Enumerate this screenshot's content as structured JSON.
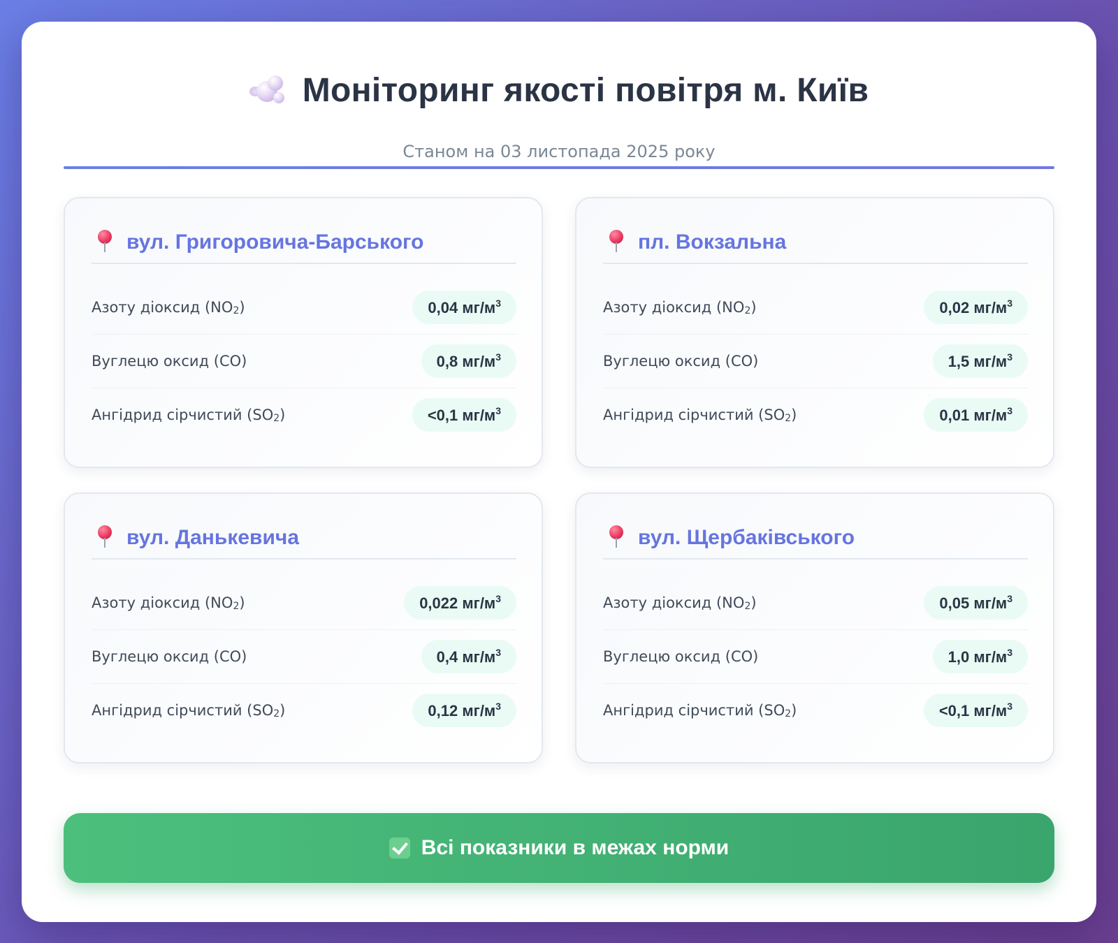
{
  "header": {
    "title": "Моніторинг якості повітря м. Київ",
    "subtitle": "Станом на 03 листопада 2025 року",
    "title_icon": "cloud-icon"
  },
  "unit": "мг/м",
  "unit_sup": "3",
  "stations": [
    {
      "name": "вул. Григоровича-Барського",
      "icon": "pin-icon",
      "readings": [
        {
          "label": "Азоту діоксид (NO",
          "sub": "2",
          "label_end": ")",
          "value": "0,04"
        },
        {
          "label": "Вуглецю оксид (CO)",
          "sub": "",
          "label_end": "",
          "value": "0,8"
        },
        {
          "label": "Ангідрид сірчистий (SO",
          "sub": "2",
          "label_end": ")",
          "value": "<0,1"
        }
      ]
    },
    {
      "name": "пл. Вокзальна",
      "icon": "pin-icon",
      "readings": [
        {
          "label": "Азоту діоксид (NO",
          "sub": "2",
          "label_end": ")",
          "value": "0,02"
        },
        {
          "label": "Вуглецю оксид (CO)",
          "sub": "",
          "label_end": "",
          "value": "1,5"
        },
        {
          "label": "Ангідрид сірчистий (SO",
          "sub": "2",
          "label_end": ")",
          "value": "0,01"
        }
      ]
    },
    {
      "name": "вул. Данькевича",
      "icon": "pin-icon",
      "readings": [
        {
          "label": "Азоту діоксид (NO",
          "sub": "2",
          "label_end": ")",
          "value": "0,022"
        },
        {
          "label": "Вуглецю оксид (CO)",
          "sub": "",
          "label_end": "",
          "value": "0,4"
        },
        {
          "label": "Ангідрид сірчистий (SO",
          "sub": "2",
          "label_end": ")",
          "value": "0,12"
        }
      ]
    },
    {
      "name": "вул. Щербаківського",
      "icon": "pin-icon",
      "readings": [
        {
          "label": "Азоту діоксид (NO",
          "sub": "2",
          "label_end": ")",
          "value": "0,05"
        },
        {
          "label": "Вуглецю оксид (CO)",
          "sub": "",
          "label_end": "",
          "value": "1,0"
        },
        {
          "label": "Ангідрид сірчистий (SO",
          "sub": "2",
          "label_end": ")",
          "value": "<0,1"
        }
      ]
    }
  ],
  "status": {
    "text": "Всі показники в межах норми",
    "icon": "check-icon",
    "color": "#4cbf7d"
  },
  "colors": {
    "accent": "#6675e0",
    "pill_bg": "#e9fbf4"
  }
}
